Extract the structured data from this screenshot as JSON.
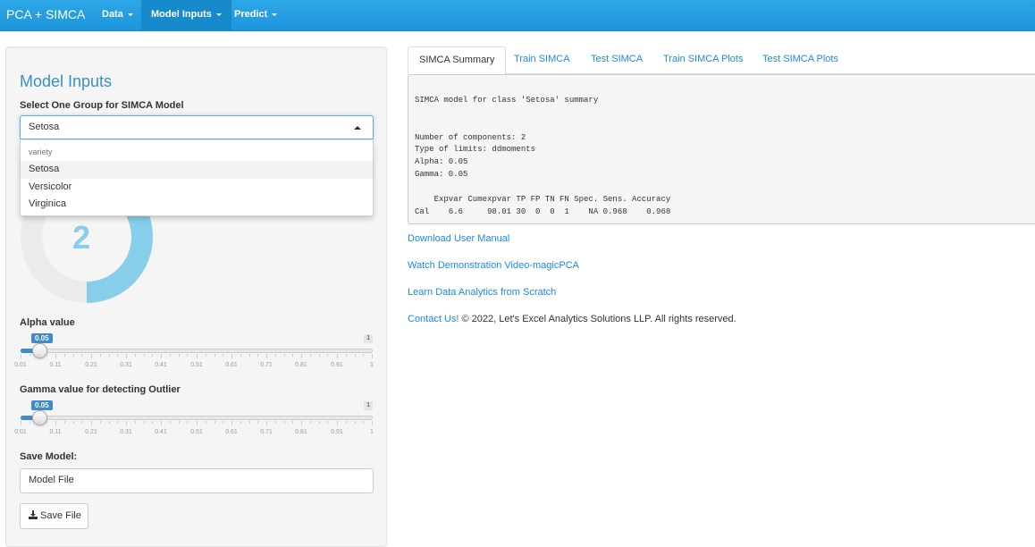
{
  "navbar": {
    "brand": "PCA + SIMCA",
    "items": [
      {
        "label": "Data"
      },
      {
        "label": "Model Inputs"
      },
      {
        "label": "Predict"
      }
    ]
  },
  "sidebar": {
    "title": "Model Inputs",
    "group_label": "Select One Group for SIMCA Model",
    "group_selected": "Setosa",
    "dropdown": {
      "group_header": "variety",
      "options": [
        "Setosa",
        "Versicolor",
        "Virginica"
      ]
    },
    "components_value": "2",
    "components_fraction": 0.5,
    "alpha": {
      "label": "Alpha value",
      "value": "0.05",
      "max": "1",
      "ticks": [
        "0.01",
        "0.11",
        "0.21",
        "0.31",
        "0.41",
        "0.51",
        "0.61",
        "0.71",
        "0.81",
        "0.91",
        "1"
      ]
    },
    "gamma": {
      "label": "Gamma value for detecting Outlier",
      "value": "0.05",
      "max": "1",
      "ticks": [
        "0.01",
        "0.11",
        "0.21",
        "0.31",
        "0.41",
        "0.51",
        "0.61",
        "0.71",
        "0.81",
        "0.91",
        "1"
      ]
    },
    "save_label": "Save Model:",
    "model_file_value": "Model File",
    "save_button": "Save File"
  },
  "tabs": [
    "SIMCA Summary",
    "Train SIMCA",
    "Test SIMCA",
    "Train SIMCA Plots",
    "Test SIMCA Plots"
  ],
  "summary": {
    "lines": [
      "SIMCA model for class 'Setosa' summary",
      "Number of components: 2",
      "Type of limits: ddmoments",
      "Alpha: 0.05",
      "Gamma: 0.05",
      "    Expvar Cumexpvar TP FP TN FN Spec. Sens. Accuracy",
      "Cal    6.6     98.01 30  0  0  1    NA 0.968    0.968"
    ]
  },
  "links": {
    "manual": "Download User Manual",
    "video": "Watch Demonstration Video-magicPCA",
    "learn": "Learn Data Analytics from Scratch"
  },
  "footer": {
    "contact": "Contact Us!",
    "copyright": " © 2022, Let's Excel Analytics Solutions LLP. All rights reserved."
  },
  "colors": {
    "navbar": "#1e95dc",
    "accent": "#428bca",
    "link": "#1e88e5",
    "donut": "#87ceeb"
  }
}
